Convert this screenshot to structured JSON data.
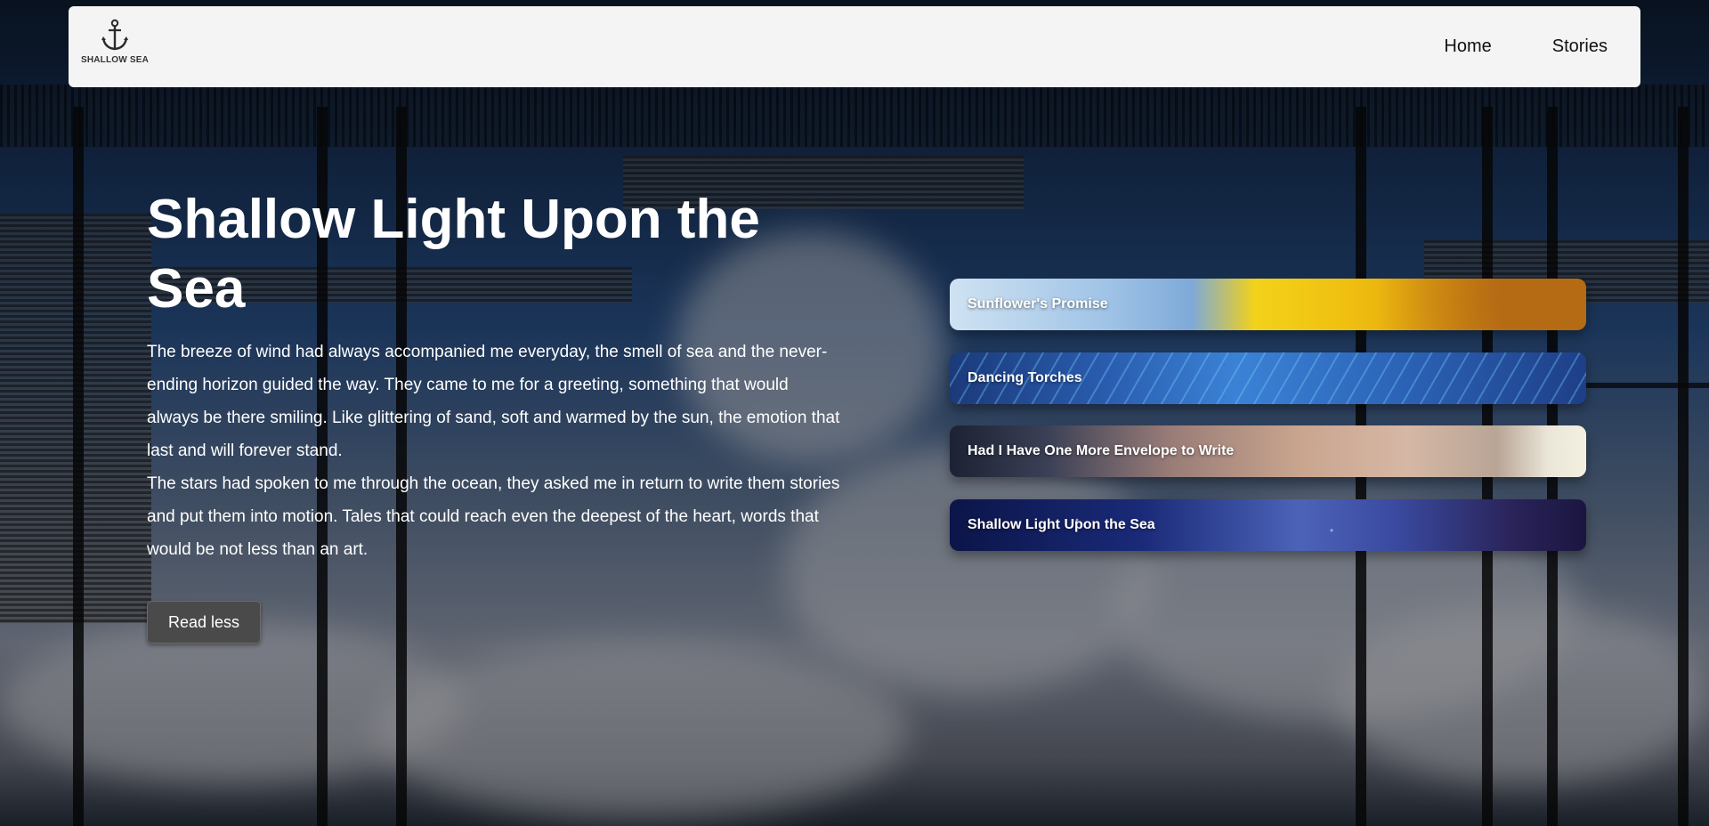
{
  "navbar": {
    "logo_text": "SHALLOW SEA",
    "links": [
      {
        "label": "Home"
      },
      {
        "label": "Stories"
      }
    ]
  },
  "hero": {
    "title": "Shallow Light Upon the Sea",
    "paragraph_1": "The breeze of wind had always accompanied me everyday, the smell of sea and the never-ending horizon guided the way. They came to me for a greeting, something that would always be there smiling. Like glittering of sand, soft and warmed by the sun, the emotion that last and will forever stand.",
    "paragraph_2": "The stars had spoken to me through the ocean, they asked me in return to write them stories and put them into motion. Tales that could reach even the deepest of the heart, words that would be not less than an art.",
    "button_label": "Read less"
  },
  "stories": [
    {
      "title": "Sunflower's Promise"
    },
    {
      "title": "Dancing Torches"
    },
    {
      "title": "Had I Have One More Envelope to Write"
    },
    {
      "title": "Shallow Light Upon the Sea"
    }
  ],
  "icons": {
    "logo": "anchor-icon"
  }
}
